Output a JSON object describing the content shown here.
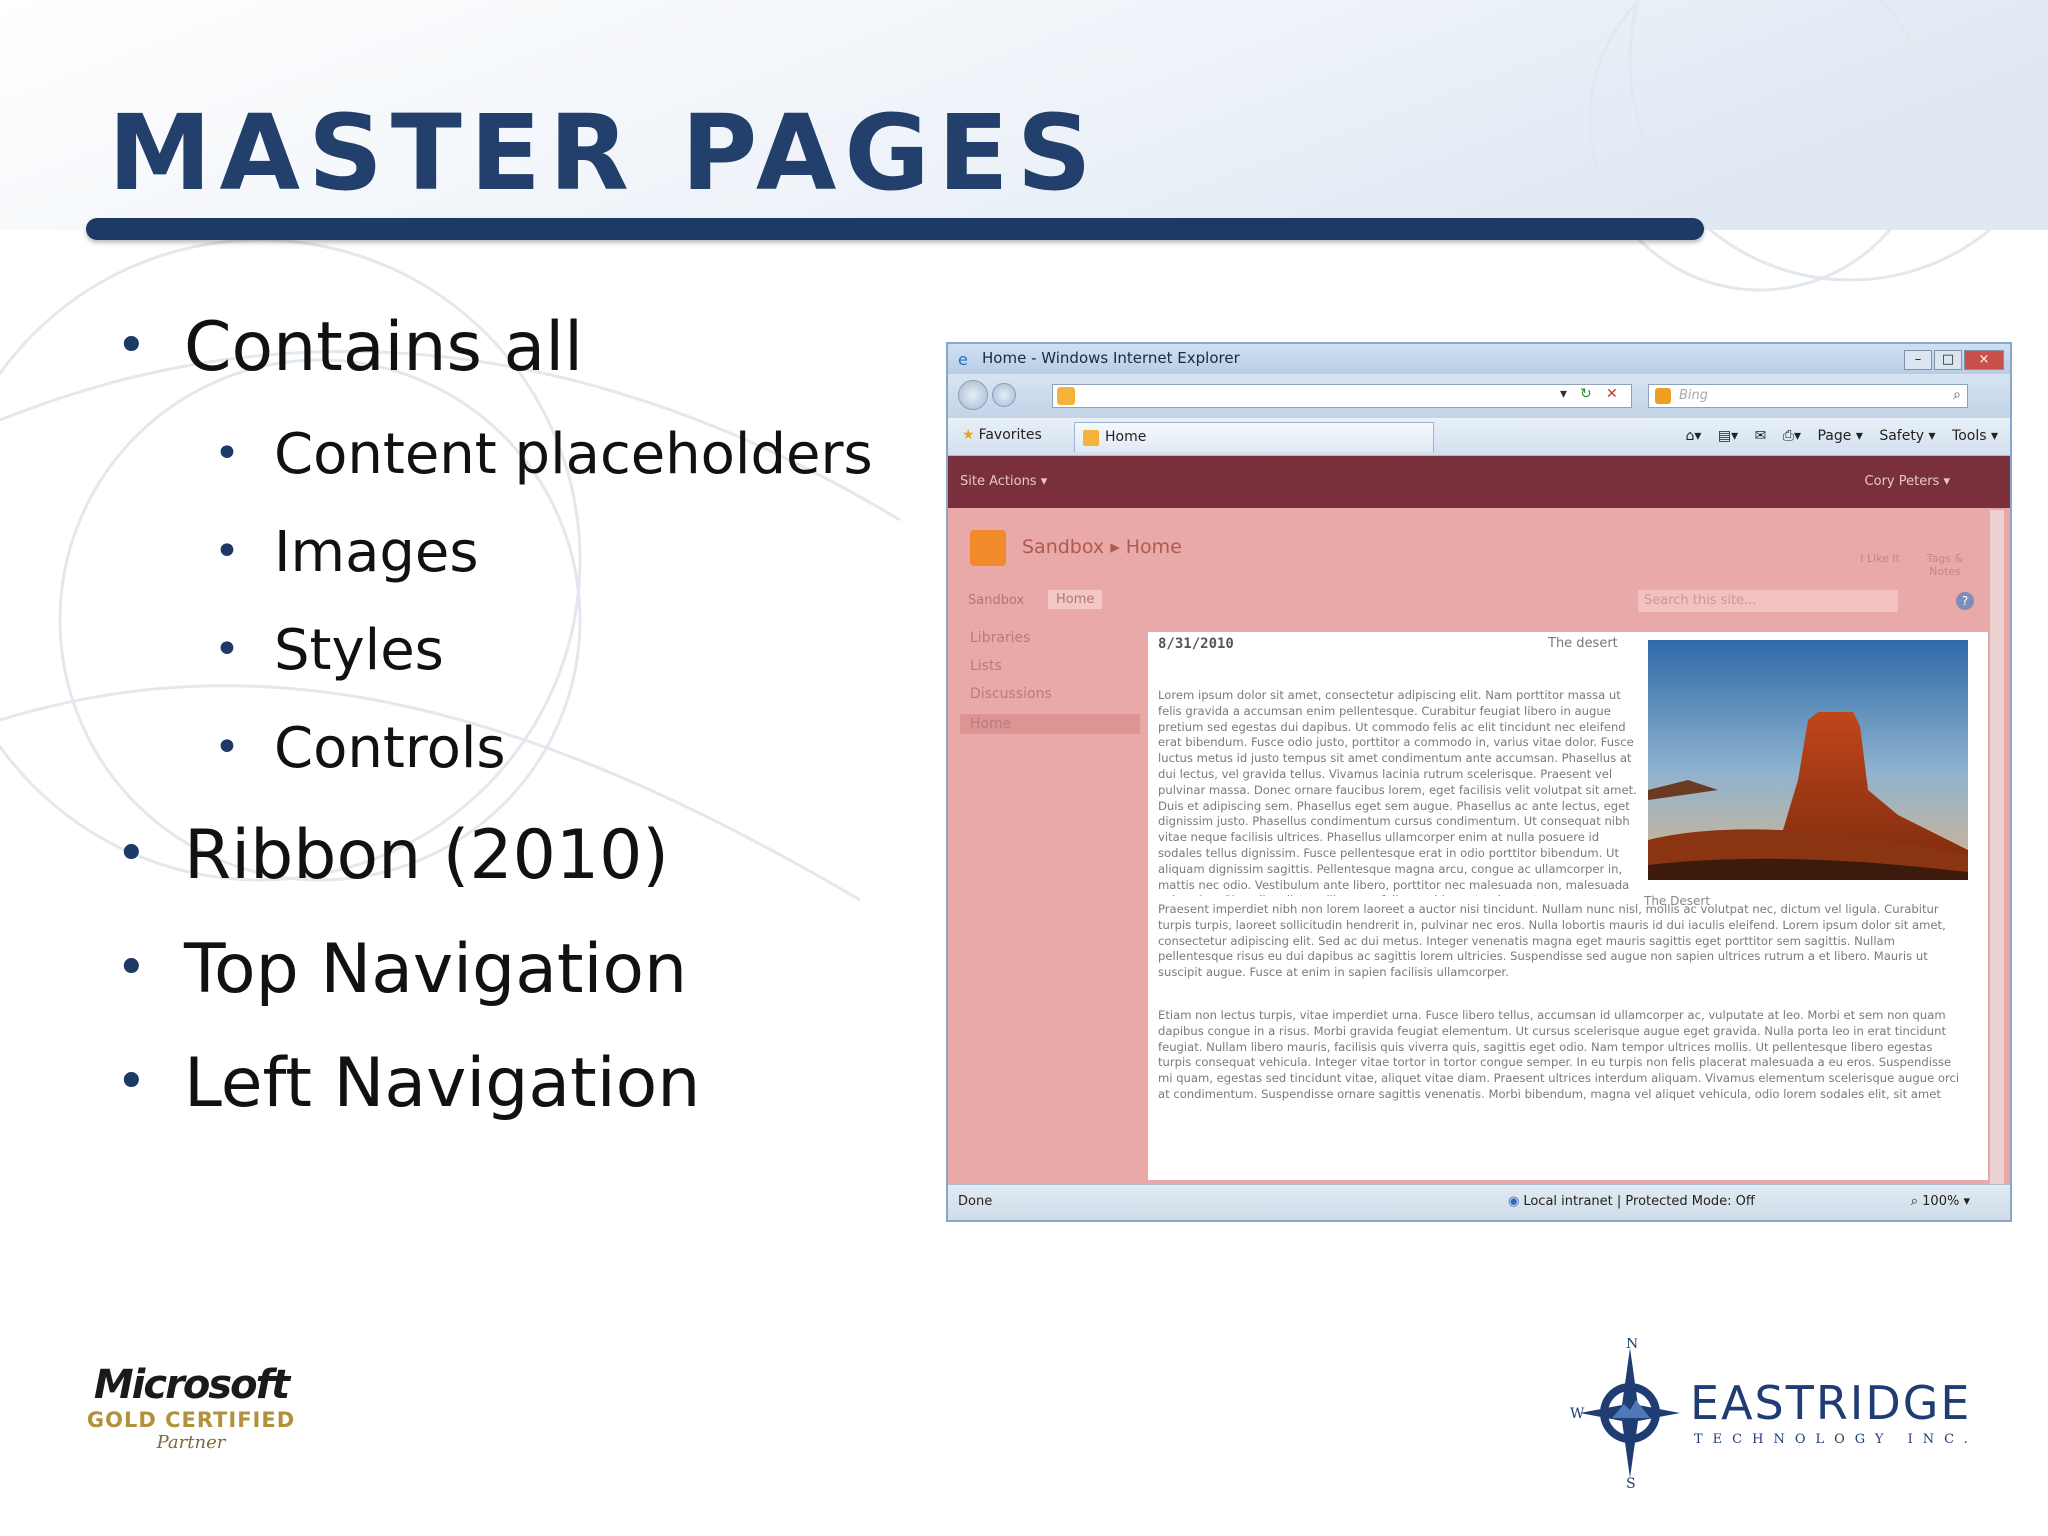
{
  "slide": {
    "title": "MASTER PAGES",
    "bullets": [
      {
        "text": "Contains all",
        "level": 1
      },
      {
        "text": "Content placeholders",
        "level": 2
      },
      {
        "text": "Images",
        "level": 2
      },
      {
        "text": "Styles",
        "level": 2
      },
      {
        "text": "Controls",
        "level": 2
      },
      {
        "text": "Ribbon (2010)",
        "level": 1
      },
      {
        "text": "Top Navigation",
        "level": 1
      },
      {
        "text": "Left Navigation",
        "level": 1
      }
    ],
    "bullet_char": "•",
    "accent_color": "#233f6b"
  },
  "browser": {
    "window_title": "Home - Windows Internet Explorer",
    "search_placeholder": "Bing",
    "favorites_label": "Favorites",
    "tab_label": "Home",
    "commands": [
      "Page ▾",
      "Safety ▾",
      "Tools ▾"
    ],
    "status_left": "Done",
    "status_zone": "Local intranet | Protected Mode: Off",
    "zoom": "100%"
  },
  "sharepoint": {
    "site_actions": "Site Actions ▾",
    "user": "Cory Peters ▾",
    "breadcrumb": "Sandbox ▸ Home",
    "like_label": "I Like It",
    "tags_label": "Tags & Notes",
    "top_nav": [
      "Sandbox",
      "Home"
    ],
    "search_placeholder": "Search this site...",
    "help": "?",
    "quick_launch": [
      "Libraries",
      "Lists",
      "Discussions",
      "Home"
    ],
    "date": "8/31/2010",
    "image_title": "The desert",
    "image_caption": "The Desert",
    "paragraphs": [
      "Lorem ipsum dolor sit amet, consectetur adipiscing elit. Nam porttitor massa ut felis gravida a accumsan enim pellentesque. Curabitur feugiat libero in augue pretium sed egestas dui dapibus. Ut commodo felis ac elit tincidunt nec eleifend erat bibendum. Fusce odio justo, porttitor a commodo in, varius vitae dolor. Fusce luctus metus id justo tempus sit amet condimentum ante accumsan. Phasellus at dui lectus, vel gravida tellus. Vivamus lacinia rutrum scelerisque. Praesent vel pulvinar massa. Donec ornare faucibus lorem, eget facilisis velit volutpat sit amet. Duis et adipiscing sem. Phasellus eget sem augue. Phasellus ac ante lectus, eget dignissim justo. Phasellus condimentum cursus condimentum. Ut consequat nibh vitae neque facilisis ultrices. Phasellus ullamcorper enim at nulla posuere id sodales tellus dignissim. Fusce pellentesque erat in odio porttitor bibendum. Ut aliquam dignissim sagittis. Pellentesque magna arcu, congue ac ullamcorper in, mattis nec odio. Vestibulum ante libero, porttitor nec malesuada non, malesuada vel sapien. Phasellus dictum libero eu felis gravida porta placerat urna pellentesque.",
      "Praesent imperdiet nibh non lorem laoreet a auctor nisi tincidunt. Nullam nunc nisl, mollis ac volutpat nec, dictum vel ligula. Curabitur turpis turpis, laoreet sollicitudin hendrerit in, pulvinar nec eros. Nulla lobortis mauris id dui iaculis eleifend. Lorem ipsum dolor sit amet, consectetur adipiscing elit. Sed ac dui metus. Integer venenatis magna eget mauris sagittis eget porttitor sem sagittis. Nullam pellentesque risus eu dui dapibus ac sagittis lorem ultricies. Suspendisse sed augue non sapien ultrices rutrum a et libero. Mauris ut suscipit augue. Fusce at enim in sapien facilisis ullamcorper.",
      "Etiam non lectus turpis, vitae imperdiet urna. Fusce libero tellus, accumsan id ullamcorper ac, vulputate at leo. Morbi et sem non quam dapibus congue in a risus. Morbi gravida feugiat elementum. Ut cursus scelerisque augue eget gravida. Nulla porta leo in erat tincidunt feugiat. Nullam libero mauris, facilisis quis viverra quis, sagittis eget odio. Nam tempor ultrices mollis. Ut pellentesque libero egestas turpis consequat vehicula. Integer vitae tortor in tortor congue semper. In eu turpis non felis placerat malesuada a eu eros. Suspendisse mi quam, egestas sed tincidunt vitae, aliquet vitae diam. Praesent ultrices interdum aliquam. Vivamus elementum scelerisque augue orci at condimentum. Suspendisse ornare sagittis venenatis. Morbi bibendum, magna vel aliquet vehicula, odio lorem sodales elit, sit amet"
    ]
  },
  "logos": {
    "microsoft": "Microsoft",
    "microsoft_sub": "GOLD CERTIFIED",
    "microsoft_partner": "Partner",
    "eastridge": "EASTRIDGE",
    "eastridge_sub": "TECHNOLOGY INC.",
    "compass_n": "N",
    "compass_s": "S",
    "compass_w": "W"
  }
}
